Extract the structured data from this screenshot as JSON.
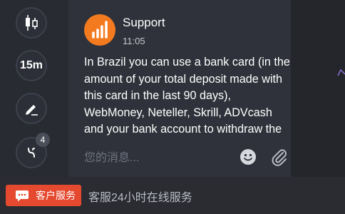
{
  "message": {
    "sender": "Support",
    "time": "11:05",
    "text": "In Brazil you can use a bank card (in the amount of your total deposit made with this card in the last 90 days), WebMoney, Neteller, Skrill, ADVcash and your bank account to withdraw the",
    "avatar_icon": "bar-chart-logo-icon"
  },
  "input": {
    "placeholder": "您的消息...",
    "emoji_icon": "smiley-icon",
    "attach_icon": "paperclip-icon"
  },
  "tools": {
    "candle_icon": "candlestick-icon",
    "timeframe": "15m",
    "draw_icon": "pencil-icon",
    "indicator_icon": "wave-indicator-icon",
    "indicator_count": "4"
  },
  "bottom_bar": {
    "button_label": "客户服务",
    "button_icon": "chat-bubble-icon",
    "service_text": "客服24小时在线服务"
  },
  "colors": {
    "accent": "#e5492f",
    "avatar": "#f47a1f",
    "background": "#2f323a"
  }
}
